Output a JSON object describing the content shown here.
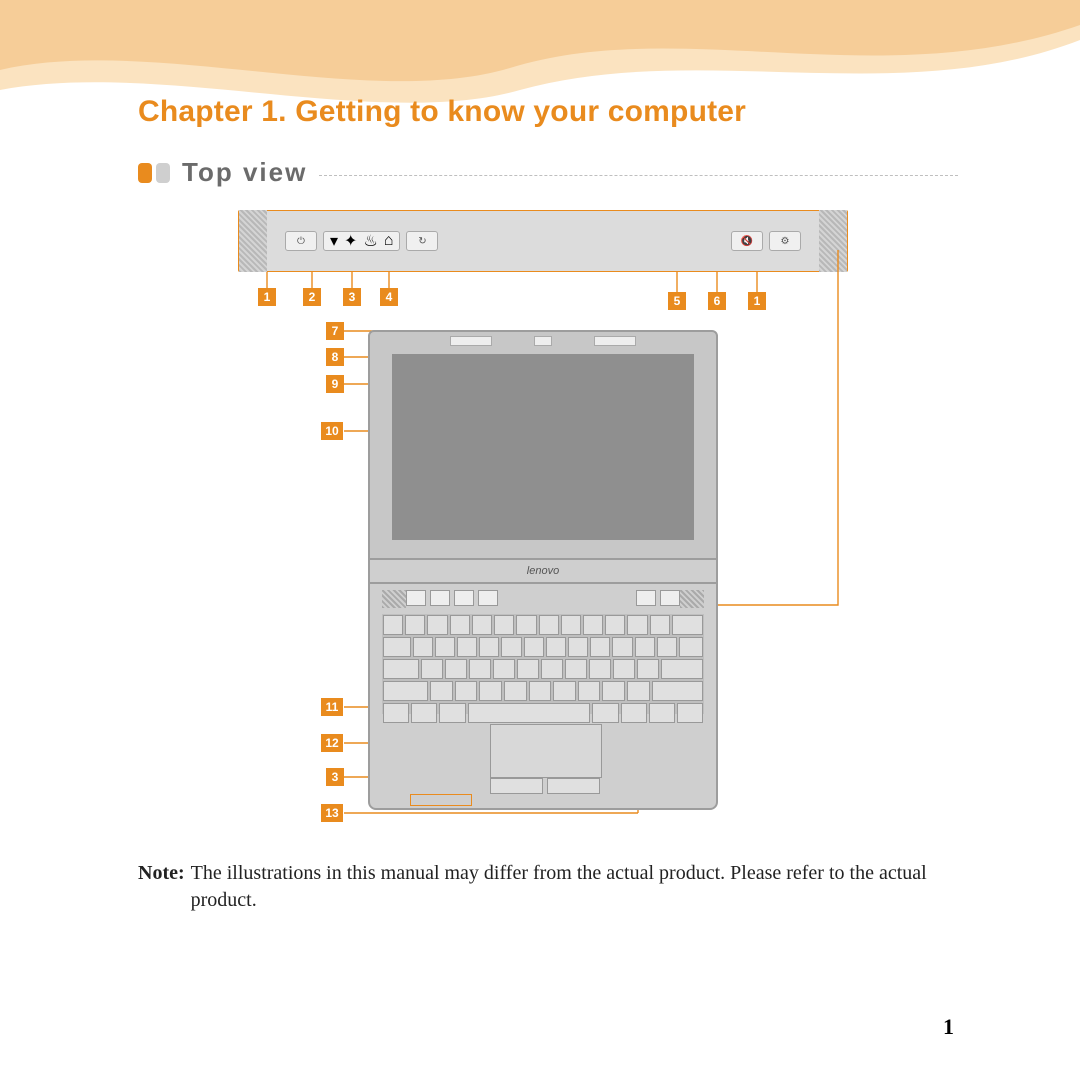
{
  "chapter_title": "Chapter 1. Getting to know your computer",
  "section_title": "Top view",
  "brand_label": "lenovo",
  "callouts": {
    "n1": "1",
    "n2": "2",
    "n3": "3",
    "n4": "4",
    "n5": "5",
    "n6": "6",
    "n1b": "1",
    "n7": "7",
    "n8": "8",
    "n9": "9",
    "n10": "10",
    "n11": "11",
    "n12": "12",
    "n3b": "3",
    "n13": "13"
  },
  "note_label": "Note:",
  "note_text": "The illustrations in this manual may differ from the actual product. Please refer to the actual product.",
  "page_number": "1"
}
